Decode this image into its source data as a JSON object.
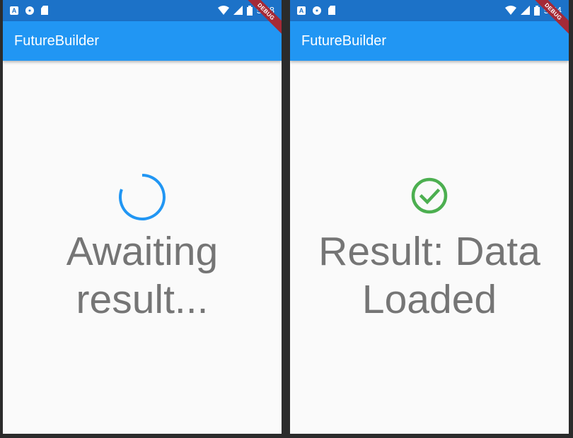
{
  "screens": [
    {
      "status_bar": {
        "time": "5:58",
        "app_icon_letter": "A"
      },
      "app_bar": {
        "title": "FutureBuilder"
      },
      "debug_banner": "DEBUG",
      "indicator_icon": "circular-progress-spinner",
      "message_line1": "Awaiting",
      "message_line2": "result..."
    },
    {
      "status_bar": {
        "time": "5:54",
        "app_icon_letter": "A"
      },
      "app_bar": {
        "title": "FutureBuilder"
      },
      "debug_banner": "DEBUG",
      "indicator_icon": "check-circle-icon",
      "message_line1": "Result: Data",
      "message_line2": "Loaded"
    }
  ],
  "colors": {
    "app_bar": "#2196f3",
    "status_bar": "#1c72c8",
    "spinner": "#2196f3",
    "success": "#4caf50",
    "message_text": "#757575",
    "debug_banner": "#a52a37"
  }
}
